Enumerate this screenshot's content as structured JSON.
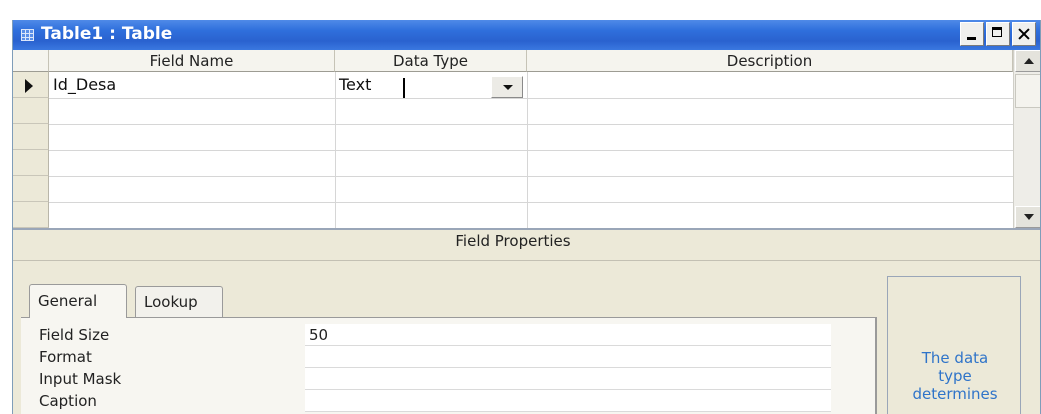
{
  "window": {
    "title": "Table1 : Table"
  },
  "grid": {
    "headers": [
      "Field Name",
      "Data Type",
      "Description"
    ],
    "rows": [
      {
        "field_name": "Id_Desa",
        "data_type": "Text",
        "description": ""
      }
    ]
  },
  "field_properties": {
    "title": "Field Properties",
    "tabs": [
      "General",
      "Lookup"
    ],
    "properties": [
      {
        "label": "Field Size",
        "value": "50"
      },
      {
        "label": "Format",
        "value": ""
      },
      {
        "label": "Input Mask",
        "value": ""
      },
      {
        "label": "Caption",
        "value": ""
      }
    ],
    "help_text": "The data\ntype\ndetermines"
  },
  "colors": {
    "title_bar": "#2f6fdc",
    "help_text": "#2f74c9",
    "window_bg": "#ece9d8"
  }
}
